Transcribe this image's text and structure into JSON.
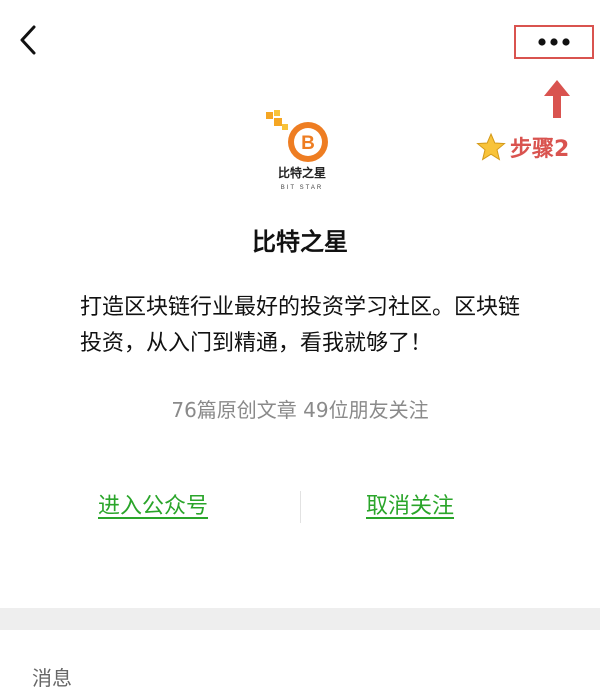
{
  "topbar": {
    "back_icon": "chevron-left-icon",
    "more_icon": "more-dots-icon",
    "highlight_color": "#d9534f"
  },
  "annotation": {
    "step_label": "步骤2",
    "arrow_icon": "up-arrow-icon",
    "star_icon": "star-icon"
  },
  "profile": {
    "logo_text": "比特之星",
    "logo_subtext": "BIT STAR",
    "name": "比特之星",
    "description": "打造区块链行业最好的投资学习社区。区块链投资，从入门到精通，看我就够了！",
    "stats": "76篇原创文章  49位朋友关注"
  },
  "actions": {
    "enter_label": "进入公众号",
    "unfollow_label": "取消关注",
    "link_color": "#2aa52a"
  },
  "section": {
    "messages_label": "消息"
  }
}
